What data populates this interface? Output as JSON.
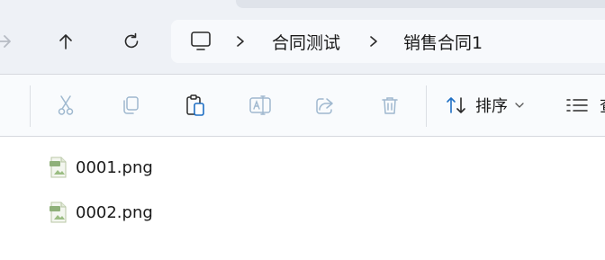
{
  "nav": {
    "forward": "forward-arrow",
    "up": "up-arrow",
    "refresh": "refresh",
    "breadcrumb": [
      {
        "label": "合同测试"
      },
      {
        "label": "销售合同1"
      }
    ]
  },
  "toolbar": {
    "sort_label": "排序",
    "view_label": "查"
  },
  "files": [
    {
      "name": "0001.png"
    },
    {
      "name": "0002.png"
    }
  ]
}
